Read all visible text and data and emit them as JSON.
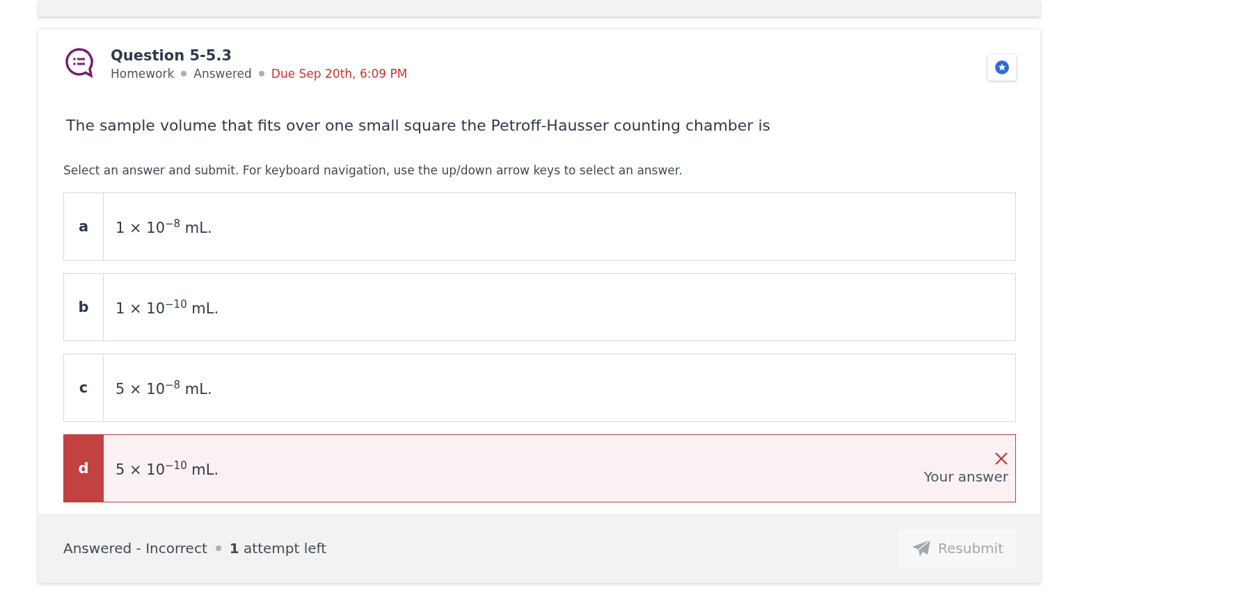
{
  "question": {
    "title": "Question 5-5.3",
    "meta": [
      {
        "kind": "plain",
        "text": "Homework"
      },
      {
        "kind": "plain",
        "text": "Answered"
      },
      {
        "kind": "due",
        "text": "Due Sep 20th, 6:09 PM"
      }
    ],
    "prompt": "The sample volume that fits over one small square the Petroff-Hausser counting chamber is",
    "instructions": "Select an answer and submit. For keyboard navigation, use the up/down arrow keys to select an answer.",
    "options": [
      {
        "letter": "a",
        "text": "1 × 10$^{−8}$ mL.",
        "selected": false
      },
      {
        "letter": "b",
        "text": "1 × 10$^{−10}$ mL.",
        "selected": false
      },
      {
        "letter": "c",
        "text": "5 × 10$^{−8}$ mL.",
        "selected": false
      },
      {
        "letter": "d",
        "text": "5 × 10$^{−10}$ mL.",
        "selected": true,
        "feedback": "Your answer"
      }
    ]
  },
  "footer": {
    "status": "Answered - Incorrect",
    "attempts": "**1** attempt left",
    "button": "Resubmit"
  }
}
